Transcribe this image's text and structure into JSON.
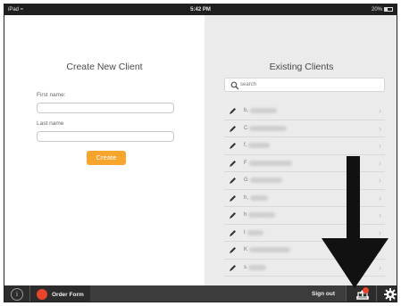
{
  "status_bar": {
    "device": "iPad",
    "time": "5:42 PM",
    "battery": "20%"
  },
  "create_client": {
    "title": "Create New Client",
    "first_name_label": "First name:",
    "first_name_value": "",
    "last_name_label": "Last name",
    "last_name_value": "",
    "create_button": "Create"
  },
  "existing_clients": {
    "title": "Existing Clients",
    "search_placeholder": "search",
    "clients": [
      {
        "name": "b,"
      },
      {
        "name": "C"
      },
      {
        "name": "f,"
      },
      {
        "name": "F"
      },
      {
        "name": "G"
      },
      {
        "name": "h,"
      },
      {
        "name": "h"
      },
      {
        "name": "I"
      },
      {
        "name": "K"
      },
      {
        "name": "s"
      }
    ]
  },
  "toolbar": {
    "order_form": "Order Form",
    "sign_out": "Sign out"
  },
  "colors": {
    "accent": "#f7a52c",
    "badge": "#e8452c",
    "toolbar": "#2c2c2c",
    "right_panel": "#ebebeb"
  },
  "icons": [
    "wifi-icon",
    "battery-icon",
    "search-icon",
    "pencil-icon",
    "chevron-right-icon",
    "info-icon",
    "order-form-icon",
    "upload-icon",
    "gear-icon",
    "down-arrow"
  ]
}
